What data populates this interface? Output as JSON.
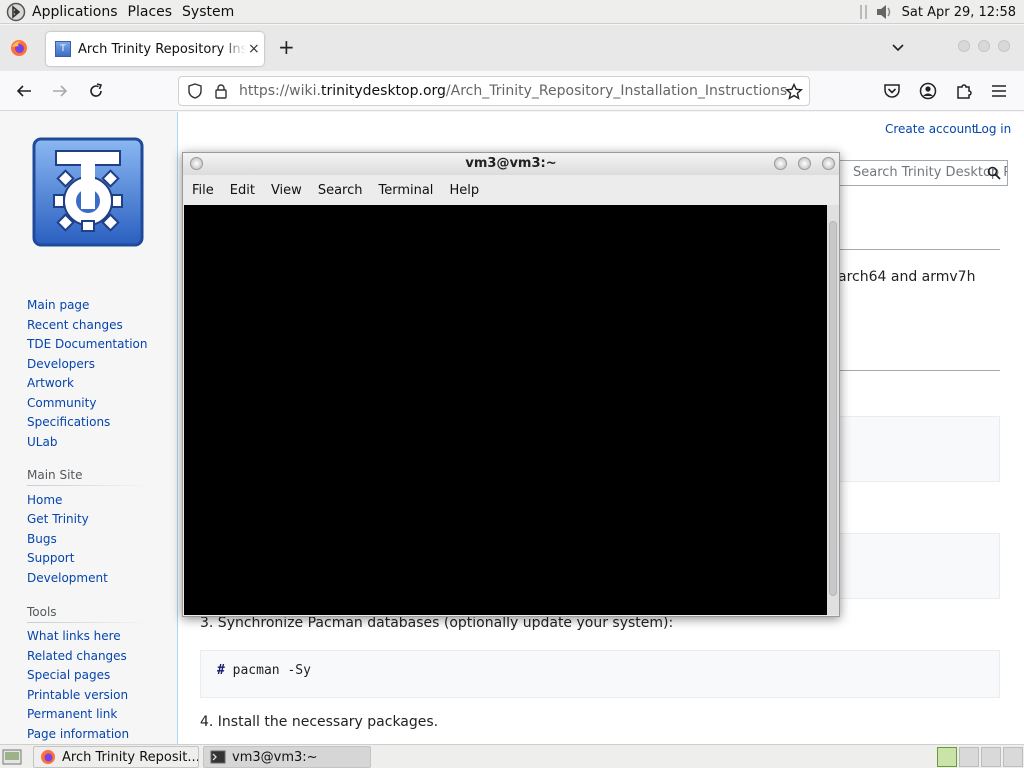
{
  "top_panel": {
    "menus": [
      "Applications",
      "Places",
      "System"
    ],
    "clock": "Sat Apr 29, 12:58"
  },
  "browser": {
    "tab_title": "Arch Trinity Repository Installation Instructions",
    "tab_close": "×",
    "new_tab": "+",
    "url_host_prefix": "https://wiki.",
    "url_host": "trinitydesktop.org",
    "url_path": "/Arch_Trinity_Repository_Installation_Instructions"
  },
  "wiki": {
    "create_account": "Create account",
    "log_in": "Log in",
    "search_placeholder": "Search Trinity Desktop Project",
    "nav_links": [
      "Main page",
      "Recent changes",
      "TDE Documentation",
      "Developers",
      "Artwork",
      "Community",
      "Specifications",
      "ULab"
    ],
    "main_site_heading": "Main Site",
    "main_site_links": [
      "Home",
      "Get Trinity",
      "Bugs",
      "Support",
      "Development"
    ],
    "tools_heading": "Tools",
    "tools_links": [
      "What links here",
      "Related changes",
      "Special pages",
      "Printable version",
      "Permanent link",
      "Page information"
    ],
    "text_arch": "arch64 and armv7h",
    "step3": "3. Synchronize Pacman databases (optionally update your system):",
    "step3_hash": "#",
    "step3_cmd": "pacman -Sy",
    "step4": "4. Install the necessary packages."
  },
  "terminal": {
    "title": "vm3@vm3:~",
    "menus": [
      "File",
      "Edit",
      "View",
      "Search",
      "Terminal",
      "Help"
    ]
  },
  "taskbar": {
    "firefox_task": "Arch Trinity Reposit...",
    "terminal_task": "vm3@vm3:~"
  },
  "colors": {
    "link": "#0645ad",
    "terminal_bg": "#000000",
    "panel": "#eeeeec"
  }
}
